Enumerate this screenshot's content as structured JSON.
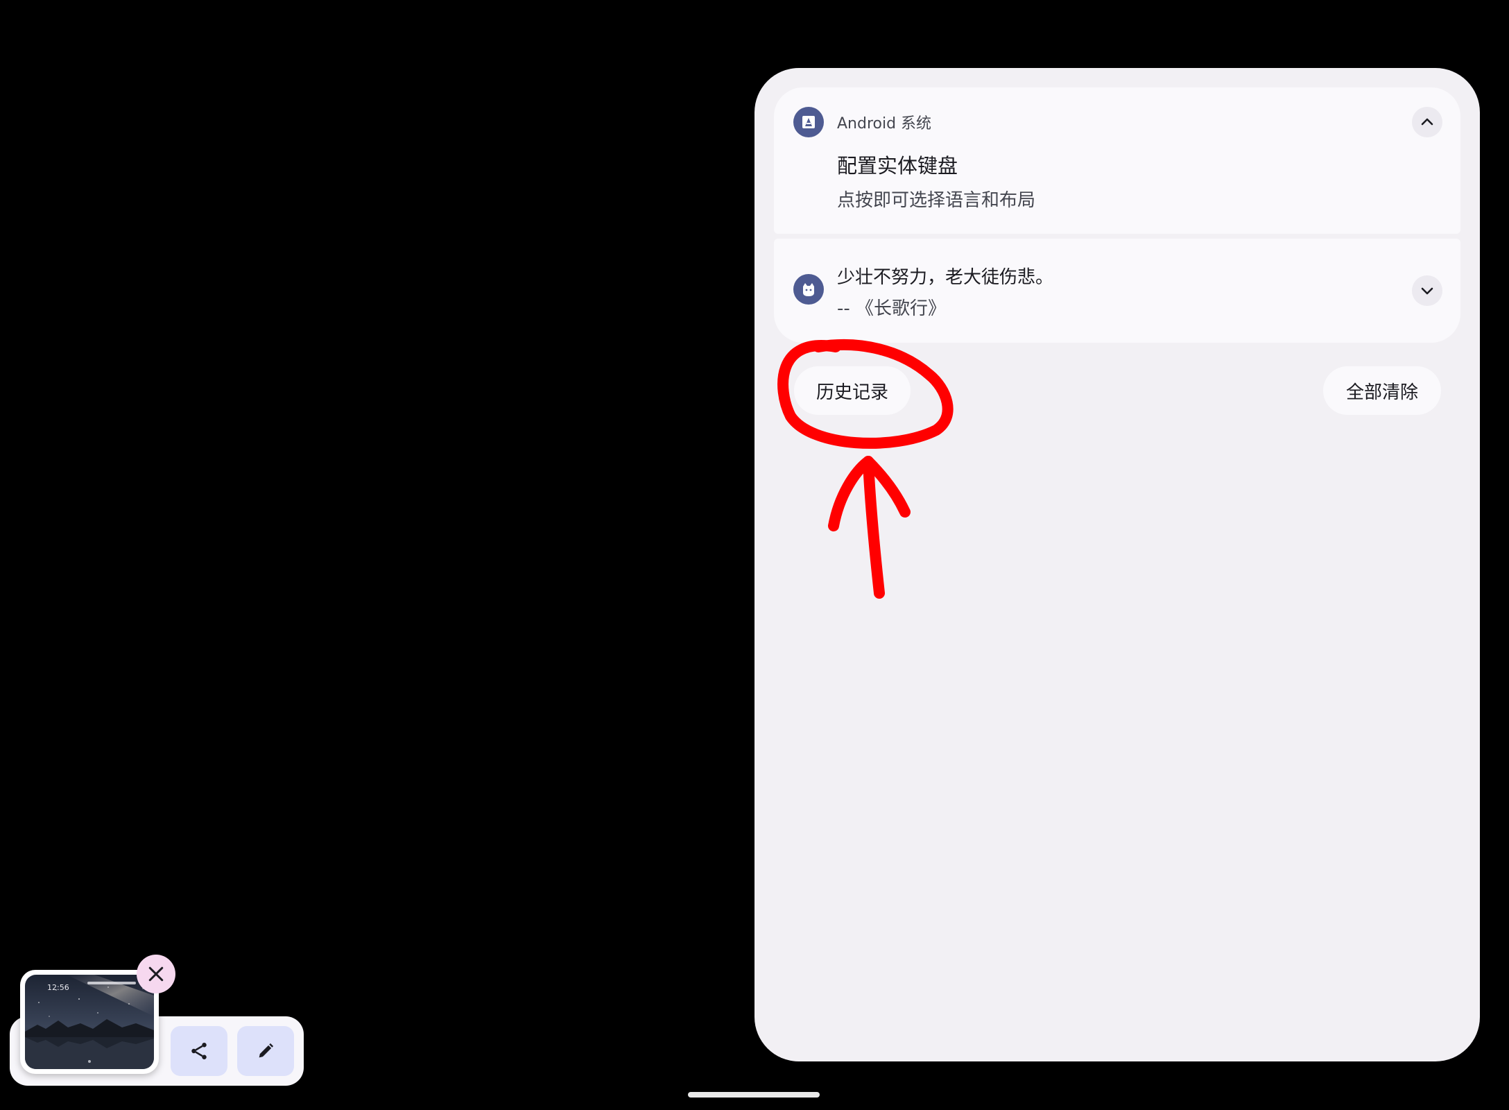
{
  "notifications": [
    {
      "app_name": "Android 系统",
      "title": "配置实体键盘",
      "text": "点按即可选择语言和布局",
      "expanded": true,
      "icon": "android-system-icon"
    },
    {
      "title": "少壮不努力，老大徒伤悲。",
      "text": "-- 《长歌行》",
      "expanded": false,
      "icon": "cat-app-icon"
    }
  ],
  "buttons": {
    "history_label": "历史记录",
    "clear_all_label": "全部清除"
  },
  "screenshot_preview": {
    "time": "12:56"
  },
  "annotation": {
    "color": "#ff0000",
    "shapes": [
      "circle-around-history",
      "arrow-pointing-up"
    ]
  },
  "colors": {
    "shade_background": "#f2f0f4",
    "card_background": "#faf9fc",
    "icon_accent": "#4e5b92",
    "tool_button": "#dde1fa",
    "close_button": "#f6d8ef"
  }
}
